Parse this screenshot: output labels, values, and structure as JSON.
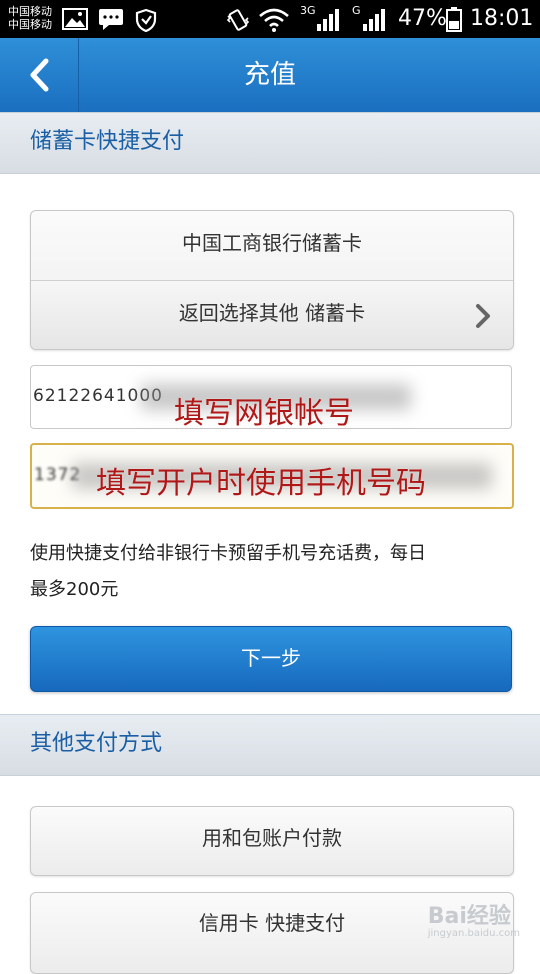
{
  "status_bar": {
    "carrier_1": "中国移动",
    "carrier_2": "中国移动",
    "network_1": "3G",
    "network_2": "G",
    "battery": "47%",
    "time": "18:01"
  },
  "header": {
    "title": "充值"
  },
  "debit_section": {
    "title": "储蓄卡快捷支付",
    "bank_label": "中国工商银行储蓄卡",
    "choose_other_label": "返回选择其他 储蓄卡",
    "card_number_value": "62122641000",
    "phone_value": "1372",
    "overlay_card": "填写网银帐号",
    "overlay_phone": "填写开户时使用手机号码",
    "info_text_line1": "使用快捷支付给非银行卡预留手机号充话费，每日",
    "info_text_line2": "最多200元",
    "next_label": "下一步"
  },
  "other_section": {
    "title": "其他支付方式",
    "option_1": "用和包账户付款",
    "option_2": "信用卡 快捷支付"
  },
  "watermark": {
    "text": "Bai经验",
    "sub": "jingyan.baidu.com"
  },
  "colors": {
    "accent": "#1a6fbf",
    "section_text": "#1a5fa5",
    "overlay_text": "#b01818",
    "active_border": "#d9b14b"
  }
}
